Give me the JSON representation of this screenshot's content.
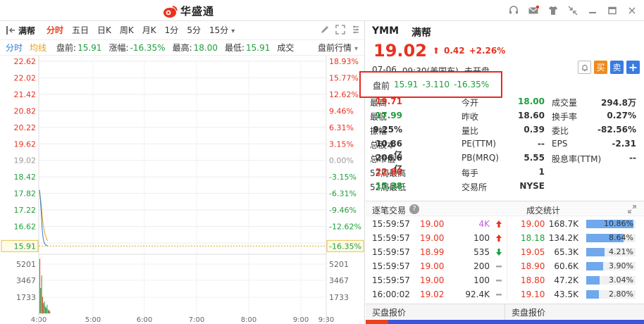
{
  "app": {
    "name": "华盛通"
  },
  "toolbar": {
    "name": "满帮",
    "periods": [
      {
        "label": "分时",
        "active": true
      },
      {
        "label": "五日"
      },
      {
        "label": "日K"
      },
      {
        "label": "周K"
      },
      {
        "label": "月K"
      },
      {
        "label": "1分"
      },
      {
        "label": "5分"
      },
      {
        "label": "15分"
      }
    ]
  },
  "infobar": {
    "fenshi": "分时",
    "junxian": "均线",
    "pre_label": "盘前:",
    "pre_value": "15.91",
    "chg_label": "涨幅:",
    "chg_value": "-16.35%",
    "high_label": "最高:",
    "high_value": "18.00",
    "low_label": "最低:",
    "low_value": "15.91",
    "vol_label": "成交",
    "market_label": "盘前行情"
  },
  "chart_data": {
    "type": "line",
    "title": "",
    "prev_close": 19.02,
    "price_axis": [
      "22.62",
      "22.02",
      "21.42",
      "20.82",
      "20.22",
      "19.62",
      "19.02",
      "18.42",
      "17.82",
      "17.22",
      "16.62",
      "16.02"
    ],
    "pct_axis": [
      "18.93%",
      "15.77%",
      "12.62%",
      "9.46%",
      "6.31%",
      "3.15%",
      "0.00%",
      "-3.15%",
      "-6.31%",
      "-9.46%",
      "-12.62%",
      "-15.77%"
    ],
    "current_price_label": "15.91",
    "current_pct_label": "-16.35%",
    "volume_axis": [
      "5201",
      "3467",
      "1733"
    ],
    "time_axis": [
      "4:00",
      "5:00",
      "6:00",
      "7:00",
      "8:00",
      "9:00",
      "9:30"
    ],
    "ylim": [
      16.02,
      22.62
    ],
    "price_series": [
      17.95,
      17.6,
      17.1,
      16.5,
      16.2,
      16.05,
      15.98,
      15.95,
      15.93,
      15.91
    ],
    "avg_series": [
      17.9,
      17.7,
      17.4,
      17.0,
      16.7,
      16.5,
      16.35,
      16.25,
      16.15,
      16.1
    ],
    "volume_ylim": [
      0,
      6935
    ],
    "volume_series": [
      6900,
      3200,
      4800,
      2100,
      1300,
      1500,
      900,
      700,
      1100,
      500,
      400,
      300
    ]
  },
  "right": {
    "symbol": "YMM",
    "name": "满帮",
    "price": "19.02",
    "arrow": "⬆",
    "change": "0.42",
    "change_pct": "+2.26%",
    "date": "07-06",
    "time": "09:30(美国东)",
    "status": "未开盘",
    "buy_label": "买",
    "sell_label": "卖",
    "more_label": "+",
    "premarket": {
      "label": "盘前",
      "value": "15.91",
      "change": "-3.110",
      "pct": "-16.35%"
    }
  },
  "stats": [
    [
      {
        "l": "最高",
        "v": "19.71",
        "c": "red"
      },
      {
        "l": "今开",
        "v": "18.00",
        "c": "green"
      },
      {
        "l": "成交量",
        "v": "294.8万",
        "c": ""
      }
    ],
    [
      {
        "l": "最低",
        "v": "17.99",
        "c": "green"
      },
      {
        "l": "昨收",
        "v": "18.60",
        "c": ""
      },
      {
        "l": "换手率",
        "v": "0.27%",
        "c": ""
      }
    ],
    [
      {
        "l": "振幅",
        "v": "9.25%",
        "c": ""
      },
      {
        "l": "量比",
        "v": "0.39",
        "c": ""
      },
      {
        "l": "委比",
        "v": "-82.56%",
        "c": ""
      }
    ],
    [
      {
        "l": "总股本",
        "v": "10.86亿",
        "c": ""
      },
      {
        "l": "PE(TTM)",
        "v": "--",
        "c": ""
      },
      {
        "l": "EPS",
        "v": "-2.31",
        "c": ""
      }
    ],
    [
      {
        "l": "总市值",
        "v": "206.6亿",
        "c": ""
      },
      {
        "l": "PB(MRQ)",
        "v": "5.55",
        "c": ""
      },
      {
        "l": "股息率(TTM)",
        "v": "--",
        "c": ""
      }
    ],
    [
      {
        "l": "52周最高",
        "v": "22.80",
        "c": "red"
      },
      {
        "l": "每手",
        "v": "1",
        "c": ""
      },
      {
        "l": "",
        "v": "",
        "c": ""
      }
    ],
    [
      {
        "l": "52周最低",
        "v": "15.38",
        "c": "green"
      },
      {
        "l": "交易所",
        "v": "NYSE",
        "c": ""
      },
      {
        "l": "",
        "v": "",
        "c": ""
      }
    ]
  ],
  "sections": {
    "ticks_title": "逐笔交易",
    "help": "?",
    "stats_title": "成交统计"
  },
  "ticks": [
    {
      "t": "15:59:57",
      "p": "19.00",
      "pc": "red",
      "v": "4K",
      "vc": "purple",
      "d": "up"
    },
    {
      "t": "15:59:57",
      "p": "19.00",
      "pc": "red",
      "v": "100",
      "vc": "",
      "d": "up"
    },
    {
      "t": "15:59:57",
      "p": "18.99",
      "pc": "red",
      "v": "535",
      "vc": "",
      "d": "down"
    },
    {
      "t": "15:59:57",
      "p": "19.00",
      "pc": "red",
      "v": "200",
      "vc": "",
      "d": "flat"
    },
    {
      "t": "15:59:57",
      "p": "19.00",
      "pc": "red",
      "v": "100",
      "vc": "",
      "d": "flat"
    },
    {
      "t": "16:00:02",
      "p": "19.02",
      "pc": "red",
      "v": "92.4K",
      "vc": "",
      "d": "flat"
    }
  ],
  "volstats": [
    {
      "p": "19.00",
      "pc": "red",
      "v": "168.7K",
      "pct": "10.86%",
      "f": 0.95
    },
    {
      "p": "18.18",
      "pc": "green",
      "v": "134.2K",
      "pct": "8.64%",
      "f": 0.76
    },
    {
      "p": "19.05",
      "pc": "red",
      "v": "65.3K",
      "pct": "4.21%",
      "f": 0.37
    },
    {
      "p": "18.90",
      "pc": "red",
      "v": "60.6K",
      "pct": "3.90%",
      "f": 0.34
    },
    {
      "p": "18.80",
      "pc": "red",
      "v": "47.2K",
      "pct": "3.04%",
      "f": 0.27
    },
    {
      "p": "19.10",
      "pc": "red",
      "v": "43.5K",
      "pct": "2.80%",
      "f": 0.25
    }
  ],
  "quotes": {
    "bid_title": "买盘报价",
    "ask_title": "卖盘报价",
    "bid_ratio": 0.08
  },
  "colors": {
    "up": "#e8321f",
    "down": "#1e9e3a",
    "avg": "#e3a21a",
    "line": "#2f7bd8",
    "highlight": "#e8281f"
  }
}
